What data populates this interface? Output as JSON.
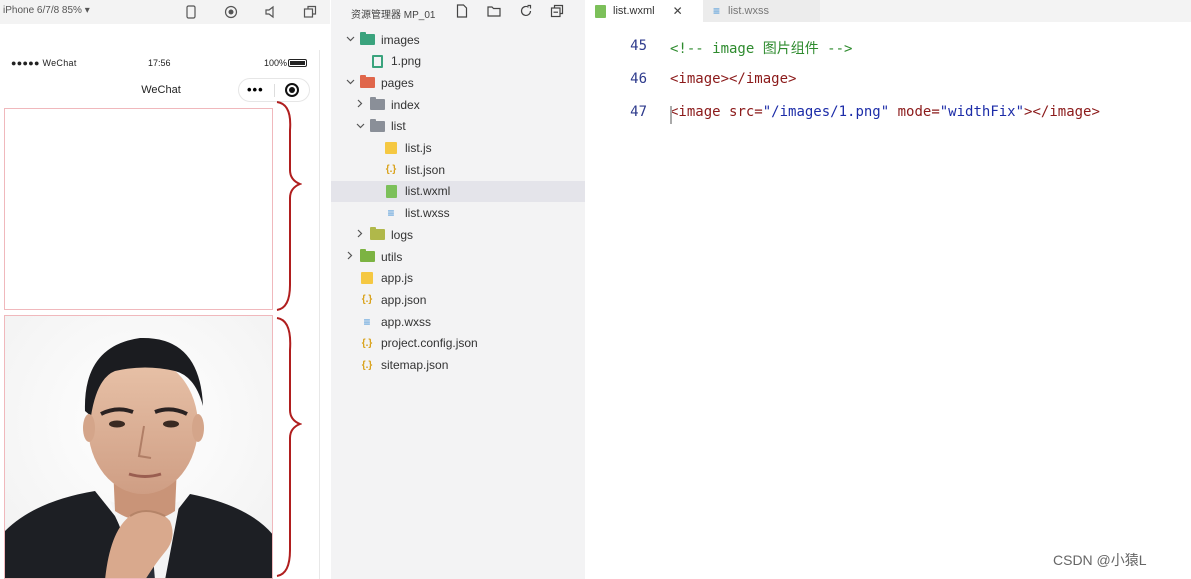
{
  "simulator": {
    "device": "iPhone 6/7/8 85% ▾",
    "status_left": "●●●●● WeChat",
    "status_time": "17:56",
    "status_battery": "100%",
    "nav_title": "WeChat",
    "capsule_more": "•••"
  },
  "explorer": {
    "title": "资源管理器 MP_01",
    "tree": [
      {
        "label": "images",
        "indent": 1,
        "chevron": "v",
        "icon": "folder-images"
      },
      {
        "label": "1.png",
        "indent": 2,
        "chevron": "",
        "icon": "png"
      },
      {
        "label": "pages",
        "indent": 1,
        "chevron": "v",
        "icon": "folder-pages"
      },
      {
        "label": "index",
        "indent": 2,
        "chevron": ">",
        "icon": "folder-gray"
      },
      {
        "label": "list",
        "indent": 2,
        "chevron": "v",
        "icon": "folder-gray"
      },
      {
        "label": "list.js",
        "indent": 3,
        "chevron": "",
        "icon": "js"
      },
      {
        "label": "list.json",
        "indent": 3,
        "chevron": "",
        "icon": "json"
      },
      {
        "label": "list.wxml",
        "indent": 3,
        "chevron": "",
        "icon": "wxml",
        "selected": true
      },
      {
        "label": "list.wxss",
        "indent": 3,
        "chevron": "",
        "icon": "wxss"
      },
      {
        "label": "logs",
        "indent": 2,
        "chevron": ">",
        "icon": "folder-logs"
      },
      {
        "label": "utils",
        "indent": 1,
        "chevron": ">",
        "icon": "folder-utils"
      },
      {
        "label": "app.js",
        "indent": 1,
        "chevron": "",
        "icon": "js"
      },
      {
        "label": "app.json",
        "indent": 1,
        "chevron": "",
        "icon": "json"
      },
      {
        "label": "app.wxss",
        "indent": 1,
        "chevron": "",
        "icon": "wxss"
      },
      {
        "label": "project.config.json",
        "indent": 1,
        "chevron": "",
        "icon": "json"
      },
      {
        "label": "sitemap.json",
        "indent": 1,
        "chevron": "",
        "icon": "json"
      }
    ]
  },
  "editor": {
    "tabs": [
      {
        "label": "list.wxml",
        "active": true,
        "close": "✕"
      },
      {
        "label": "list.wxss",
        "active": false
      }
    ],
    "lines": [
      {
        "num": "45",
        "parts": [
          {
            "t": "<!-- image 图片组件 -->",
            "c": "comment"
          }
        ]
      },
      {
        "num": "46",
        "parts": [
          {
            "t": "<image></image>",
            "c": "tag"
          }
        ]
      },
      {
        "num": "47",
        "parts": [
          {
            "t": "<image ",
            "c": "tag"
          },
          {
            "t": "src=",
            "c": "attr"
          },
          {
            "t": "\"/images/1.png\"",
            "c": "str"
          },
          {
            "t": " mode=",
            "c": "attr"
          },
          {
            "t": "\"widthFix\"",
            "c": "str"
          },
          {
            "t": "></image>",
            "c": "tag"
          }
        ]
      }
    ]
  },
  "watermark": "CSDN @小猿L"
}
